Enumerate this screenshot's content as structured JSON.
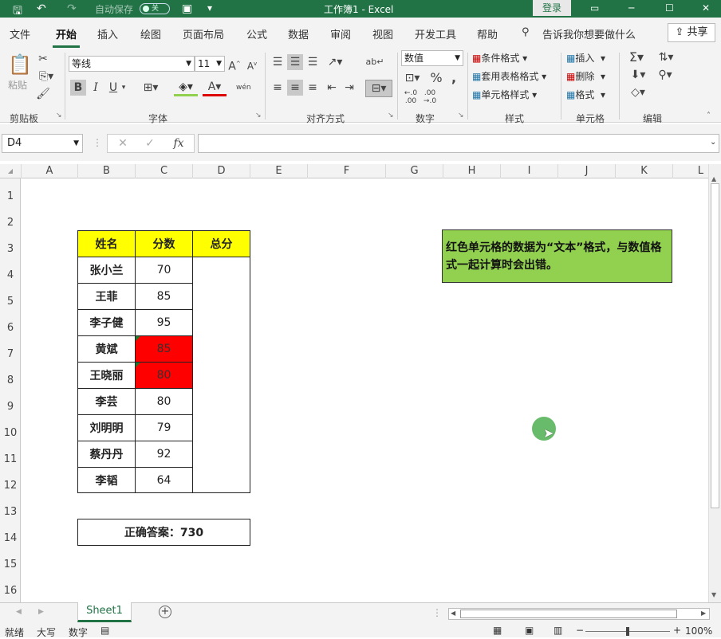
{
  "title_bar": {
    "autosave_label": "自动保存",
    "autosave_state": "关",
    "doc_title": "工作簿1 - Excel",
    "login_label": "登录"
  },
  "menu": {
    "items": [
      "文件",
      "开始",
      "插入",
      "绘图",
      "页面布局",
      "公式",
      "数据",
      "审阅",
      "视图",
      "开发工具",
      "帮助"
    ],
    "active": "开始",
    "tell_me": "告诉我你想要做什么",
    "share": "共享"
  },
  "ribbon": {
    "clipboard": {
      "paste_label": "粘贴",
      "group": "剪贴板"
    },
    "font": {
      "name": "等线",
      "size": "11",
      "group": "字体",
      "bold": "B",
      "italic": "I",
      "underline": "U"
    },
    "alignment": {
      "group": "对齐方式"
    },
    "number": {
      "format": "数值",
      "group": "数字"
    },
    "styles": {
      "conditional": "条件格式",
      "table_format": "套用表格格式",
      "cell_style": "单元格样式",
      "group": "样式"
    },
    "cells": {
      "insert": "插入",
      "delete": "删除",
      "format": "格式",
      "group": "单元格"
    },
    "editing": {
      "group": "编辑"
    }
  },
  "formula_bar": {
    "name_box": "D4",
    "formula": ""
  },
  "columns": [
    "A",
    "B",
    "C",
    "D",
    "E",
    "F",
    "G",
    "H",
    "I",
    "J",
    "K",
    "L"
  ],
  "rows": [
    "1",
    "2",
    "3",
    "4",
    "5",
    "6",
    "7",
    "8",
    "9",
    "10",
    "11",
    "12",
    "13",
    "14",
    "15",
    "16"
  ],
  "table": {
    "headers": [
      "姓名",
      "分数",
      "总分"
    ],
    "rows": [
      {
        "name": "张小兰",
        "score": "70",
        "text_format": false
      },
      {
        "name": "王菲",
        "score": "85",
        "text_format": false
      },
      {
        "name": "李子健",
        "score": "95",
        "text_format": false
      },
      {
        "name": "黄斌",
        "score": "85",
        "text_format": true
      },
      {
        "name": "王晓丽",
        "score": "80",
        "text_format": true
      },
      {
        "name": "李芸",
        "score": "80",
        "text_format": false
      },
      {
        "name": "刘明明",
        "score": "79",
        "text_format": false
      },
      {
        "name": "蔡丹丹",
        "score": "92",
        "text_format": false
      },
      {
        "name": "李韬",
        "score": "64",
        "text_format": false
      }
    ],
    "answer": "正确答案：730"
  },
  "note": "红色单元格的数据为“文本”格式，与数值格式一起计算时会出错。",
  "sheet_tab": "Sheet1",
  "status": {
    "ready": "就绪",
    "caps": "大写",
    "num": "数字",
    "zoom": "100%"
  },
  "colors": {
    "excel_green": "#217346",
    "header_yellow": "#ffff00",
    "text_cell_red": "#ff0000",
    "note_green": "#92d050"
  }
}
